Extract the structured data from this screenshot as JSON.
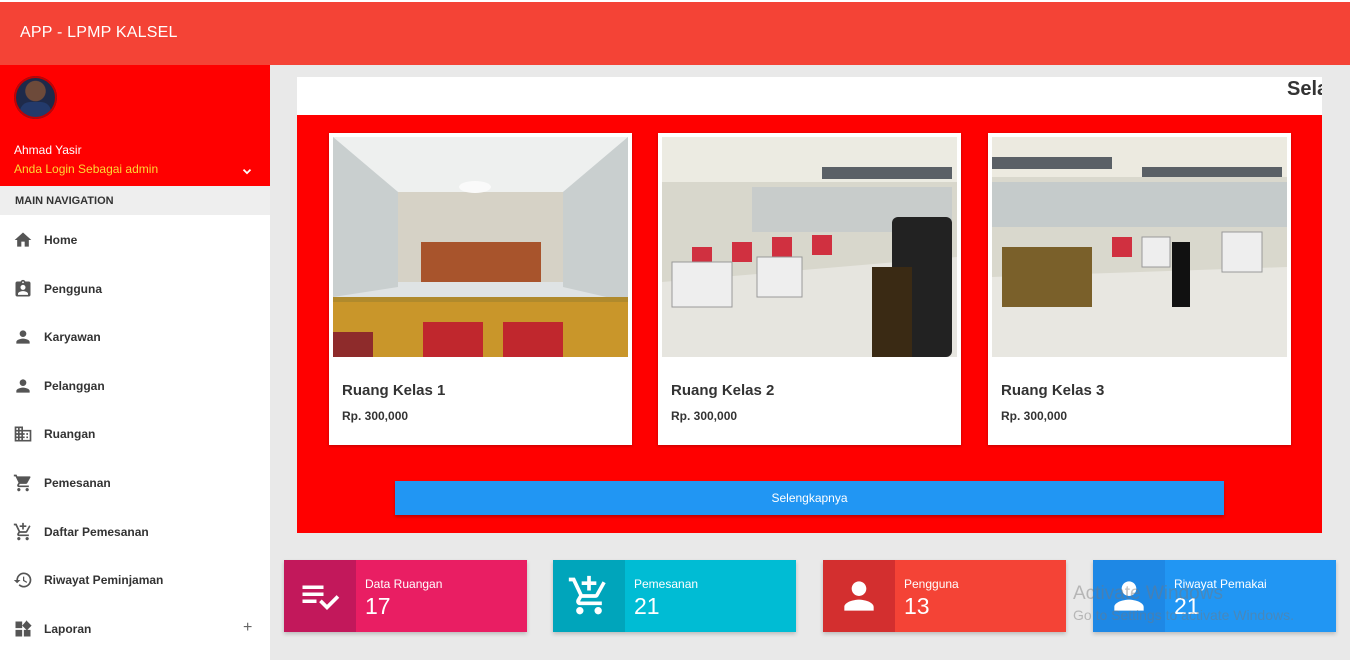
{
  "app": {
    "title": "APP - LPMP KALSEL"
  },
  "user": {
    "name": "Ahmad Yasir",
    "role": "Anda Login Sebagai admin"
  },
  "sidebar": {
    "heading": "MAIN NAVIGATION",
    "items": [
      {
        "label": "Home",
        "icon": "home-icon"
      },
      {
        "label": "Pengguna",
        "icon": "assignment-ind-icon"
      },
      {
        "label": "Karyawan",
        "icon": "person-icon"
      },
      {
        "label": "Pelanggan",
        "icon": "person-icon"
      },
      {
        "label": "Ruangan",
        "icon": "building-icon"
      },
      {
        "label": "Pemesanan",
        "icon": "cart-icon"
      },
      {
        "label": "Daftar Pemesanan",
        "icon": "add-cart-icon"
      },
      {
        "label": "Riwayat Peminjaman",
        "icon": "history-icon"
      },
      {
        "label": "Laporan",
        "icon": "widgets-icon",
        "expand": "+"
      }
    ]
  },
  "main": {
    "title": "Sela",
    "rooms": [
      {
        "name": "Ruang Kelas 1",
        "price": "Rp. 300,000"
      },
      {
        "name": "Ruang Kelas 2",
        "price": "Rp. 300,000"
      },
      {
        "name": "Ruang Kelas 3",
        "price": "Rp. 300,000"
      }
    ],
    "more_label": "Selengkapnya"
  },
  "stats": [
    {
      "label": "Data Ruangan",
      "value": "17",
      "icon": "playlist-check-icon",
      "color": "#e91e63",
      "icon_bg": "#c2185b"
    },
    {
      "label": "Pemesanan",
      "value": "21",
      "icon": "add-cart-icon",
      "color": "#00bcd4",
      "icon_bg": "#00a5bb"
    },
    {
      "label": "Pengguna",
      "value": "13",
      "icon": "person-icon",
      "color": "#f44336",
      "icon_bg": "#d32f2f"
    },
    {
      "label": "Riwayat Pemakai",
      "value": "21",
      "icon": "person-icon",
      "color": "#2196f3",
      "icon_bg": "#1e88e5"
    }
  ],
  "watermark": {
    "line1": "Activate Windows",
    "line2": "Go to Settings to activate Windows."
  }
}
